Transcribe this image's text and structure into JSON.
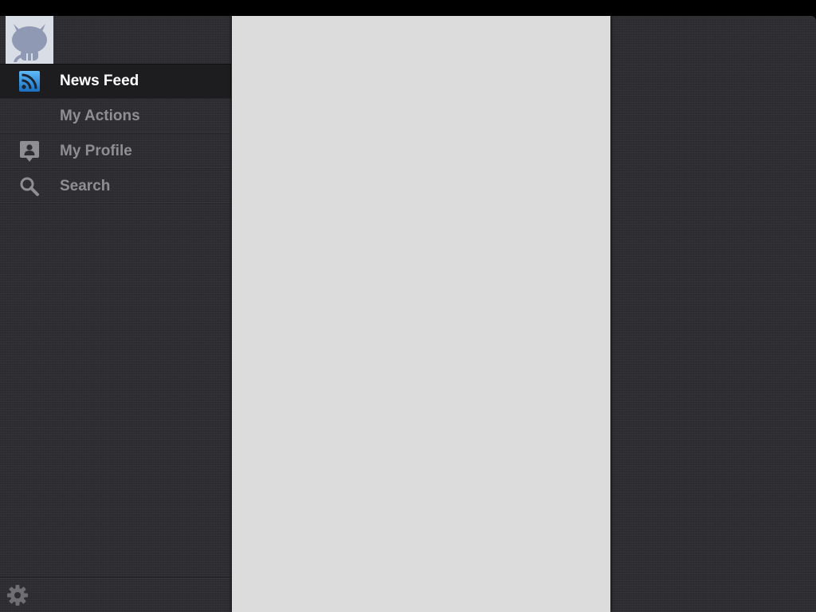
{
  "sidebar": {
    "avatar": {
      "icon": "octocat-icon"
    },
    "items": [
      {
        "label": "News Feed",
        "icon": "rss-icon",
        "active": true
      },
      {
        "label": "My Actions",
        "icon": "",
        "active": false
      },
      {
        "label": "My Profile",
        "icon": "profile-icon",
        "active": false
      },
      {
        "label": "Search",
        "icon": "search-icon",
        "active": false
      }
    ],
    "footer": {
      "icon": "gear-icon"
    }
  },
  "colors": {
    "sidebar_bg": "#2e2e32",
    "content_bg": "#dcdcdc",
    "active_label": "#ffffff",
    "inactive_label": "#8e8e93",
    "rss_accent": "#2e8fe0"
  }
}
